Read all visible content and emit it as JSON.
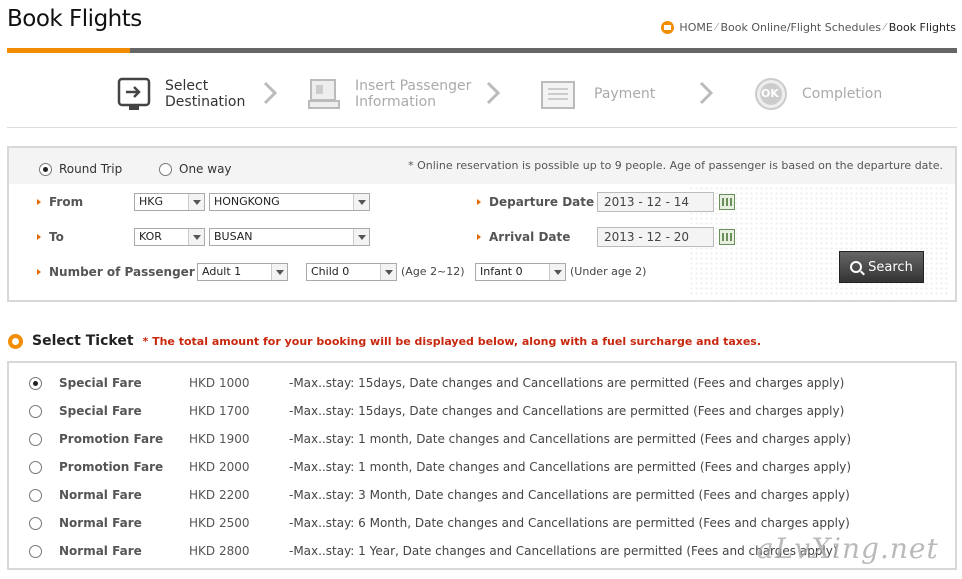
{
  "page": {
    "title": "Book Flights"
  },
  "breadcrumb": {
    "home": "HOME",
    "sep": "⁄",
    "mid": "Book Online/Flight Schedules",
    "current": "Book Flights"
  },
  "steps": [
    {
      "line1": "Select",
      "line2": "Destination",
      "icon": "select-destination-icon",
      "active": true
    },
    {
      "line1": "Insert Passenger",
      "line2": "Information",
      "icon": "passenger-icon",
      "active": false
    },
    {
      "line1": "Payment",
      "line2": "",
      "icon": "payment-icon",
      "active": false
    },
    {
      "line1": "Completion",
      "line2": "",
      "icon": "ok-icon",
      "active": false,
      "badge": "OK"
    }
  ],
  "search": {
    "trip_round": "Round Trip",
    "trip_oneway": "One way",
    "note": "* Online reservation is possible up to 9 people. Age of passenger is based on the departure date.",
    "from_label": "From",
    "from_code": "HKG",
    "from_city": "HONGKONG",
    "to_label": "To",
    "to_code": "KOR",
    "to_city": "BUSAN",
    "passenger_label": "Number of Passenger",
    "adult": "Adult 1",
    "child": "Child 0",
    "child_hint": "(Age 2~12)",
    "infant": "Infant 0",
    "infant_hint": "(Under age 2)",
    "departure_label": "Departure Date",
    "departure_value": "2013 - 12 - 14",
    "arrival_label": "Arrival Date",
    "arrival_value": "2013 - 12 - 20",
    "search_button": "Search"
  },
  "tickets_section": {
    "title": "Select Ticket",
    "note": "* The total amount for your booking will be displayed below, along with a fuel surcharge and taxes."
  },
  "tickets": [
    {
      "name": "Special Fare",
      "price": "HKD 1000",
      "desc": "-Max..stay: 15days, Date changes and Cancellations are permitted (Fees and charges apply)",
      "selected": true
    },
    {
      "name": "Special Fare",
      "price": "HKD 1700",
      "desc": "-Max..stay: 15days, Date changes and Cancellations are permitted (Fees and charges apply)",
      "selected": false
    },
    {
      "name": "Promotion Fare",
      "price": "HKD 1900",
      "desc": "-Max..stay: 1 month, Date changes and Cancellations are permitted (Fees and charges apply)",
      "selected": false
    },
    {
      "name": "Promotion Fare",
      "price": "HKD 2000",
      "desc": "-Max..stay: 1 month, Date changes and Cancellations are permitted (Fees and charges apply)",
      "selected": false
    },
    {
      "name": "Normal Fare",
      "price": "HKD 2200",
      "desc": "-Max..stay: 3 Month, Date changes and Cancellations are permitted (Fees and charges apply)",
      "selected": false
    },
    {
      "name": "Normal Fare",
      "price": "HKD 2500",
      "desc": "-Max..stay: 6 Month, Date changes and Cancellations are permitted (Fees and charges apply)",
      "selected": false
    },
    {
      "name": "Normal Fare",
      "price": "HKD 2800",
      "desc": "-Max..stay: 1 Year, Date changes and Cancellations are permitted (Fees and charges apply)",
      "selected": false
    }
  ],
  "watermark": "aLvXing.net",
  "colors": {
    "accent": "#f28c00",
    "note_red": "#c8280e"
  }
}
